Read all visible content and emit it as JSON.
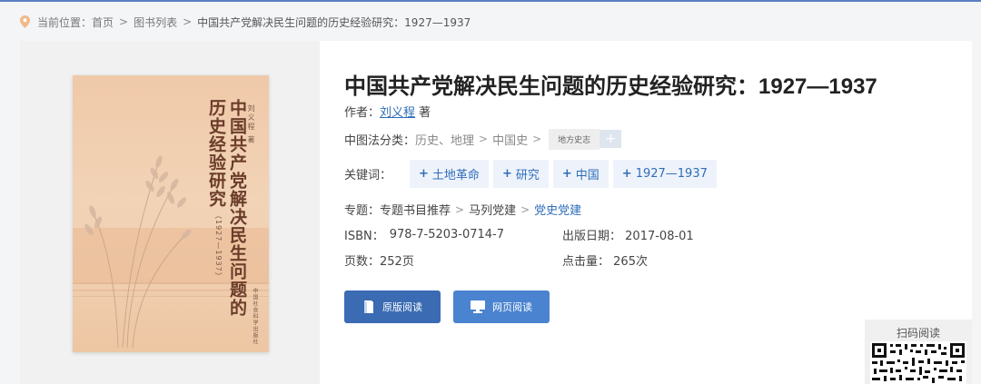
{
  "breadcrumb": {
    "prefix": "当前位置：",
    "items": [
      "首页",
      "图书列表"
    ],
    "current": "中国共产党解决民生问题的历史经验研究：1927—1937"
  },
  "book": {
    "title": "中国共产党解决民生问题的历史经验研究：1927—1937",
    "author_label": "作者：",
    "author": "刘义程",
    "author_suffix": "著",
    "classification_label": "中图法分类：",
    "classification": [
      "历史、地理",
      "中国史",
      "地方史志"
    ],
    "keywords_label": "关键词：",
    "keywords": [
      "土地革命",
      "研究",
      "中国",
      "1927—1937"
    ],
    "topic_label": "专题：",
    "topics": [
      "专题书目推荐",
      "马列党建",
      "党史党建"
    ],
    "isbn_label": "ISBN：",
    "isbn": "978-7-5203-0714-7",
    "pubdate_label": "出版日期：",
    "pubdate": "2017-08-01",
    "pages_label": "页数：",
    "pages": "252页",
    "clicks_label": "点击量：",
    "clicks": "265次"
  },
  "cover": {
    "title_line1": "中国共产党解决民生问题的",
    "title_line2": "历史经验研究",
    "years": "（1927—1937）",
    "author": "刘义程 著",
    "publisher": "中国社会科学出版社"
  },
  "buttons": {
    "original": "原版阅读",
    "web": "网页阅读"
  },
  "qr": {
    "label": "扫码阅读"
  },
  "colors": {
    "accent": "#3a6bb3",
    "link": "#2f6db8",
    "keyword_bg": "#eef3fb"
  },
  "icons": [
    "location-pin-icon",
    "book-icon",
    "monitor-icon",
    "qr-code-icon",
    "plus-icon"
  ]
}
